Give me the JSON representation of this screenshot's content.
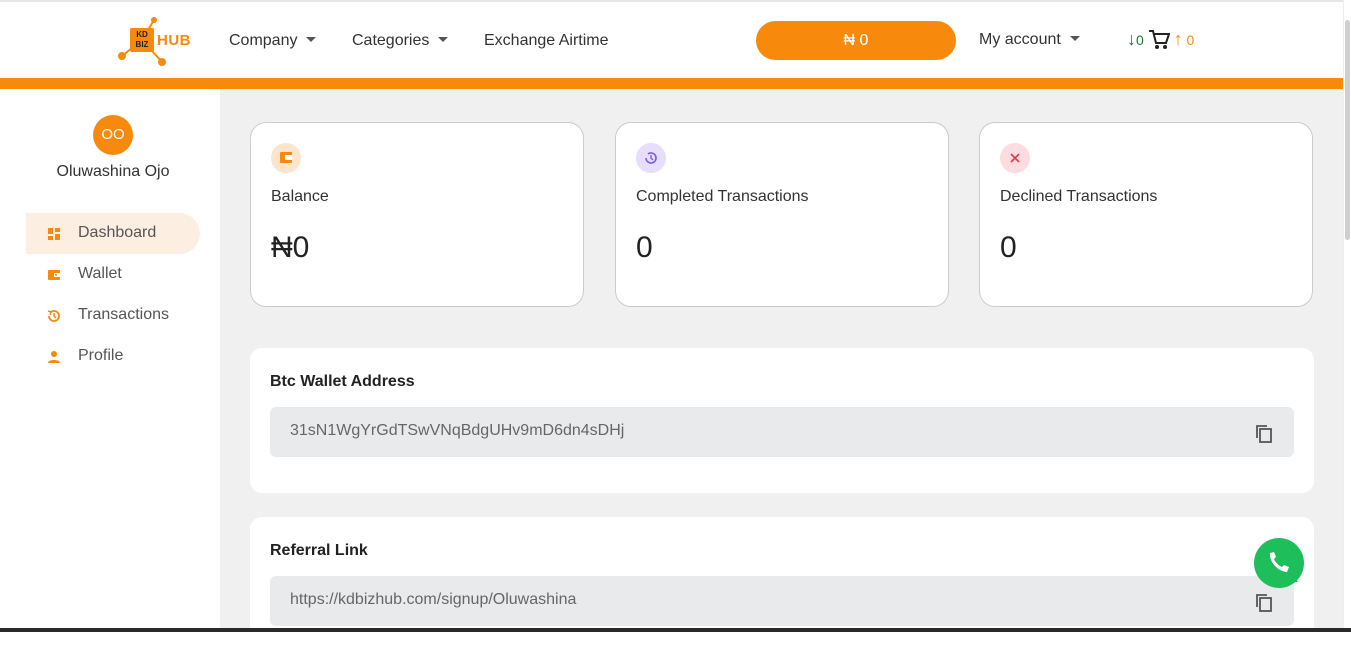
{
  "header": {
    "logo": {
      "box_top": "KD",
      "box_bottom": "BIZ",
      "text": "HUB"
    },
    "nav": [
      {
        "label": "Company",
        "dropdown": true
      },
      {
        "label": "Categories",
        "dropdown": true
      },
      {
        "label": "Exchange Airtime",
        "dropdown": false
      }
    ],
    "balance_pill": "₦ 0",
    "account_label": "My account",
    "incoming_count": "0",
    "outgoing_count": "0"
  },
  "sidebar": {
    "avatar_initials": "OO",
    "username": "Oluwashina Ojo",
    "items": [
      {
        "label": "Dashboard",
        "icon": "dashboard-icon",
        "active": true
      },
      {
        "label": "Wallet",
        "icon": "wallet-icon",
        "active": false
      },
      {
        "label": "Transactions",
        "icon": "history-icon",
        "active": false
      },
      {
        "label": "Profile",
        "icon": "person-icon",
        "active": false
      }
    ]
  },
  "cards": [
    {
      "label": "Balance",
      "value": "₦0",
      "icon": "wallet-icon",
      "icon_bg": "#fde4cc",
      "icon_color": "#f7890c"
    },
    {
      "label": "Completed Transactions",
      "value": "0",
      "icon": "history-icon",
      "icon_bg": "#e6defc",
      "icon_color": "#7a5af5"
    },
    {
      "label": "Declined Transactions",
      "value": "0",
      "icon": "close-icon",
      "icon_bg": "#fcdcdf",
      "icon_color": "#e0394b"
    }
  ],
  "btc_wallet": {
    "title": "Btc Wallet Address",
    "value": "31sN1WgYrGdTSwVNqBdgUHv9mD6dn4sDHj"
  },
  "referral": {
    "title": "Referral Link",
    "value": "https://kdbizhub.com/signup/Oluwashina"
  },
  "colors": {
    "accent": "#f7890c",
    "main_bg": "#f0f0f0",
    "whatsapp": "#1ebe5a"
  }
}
